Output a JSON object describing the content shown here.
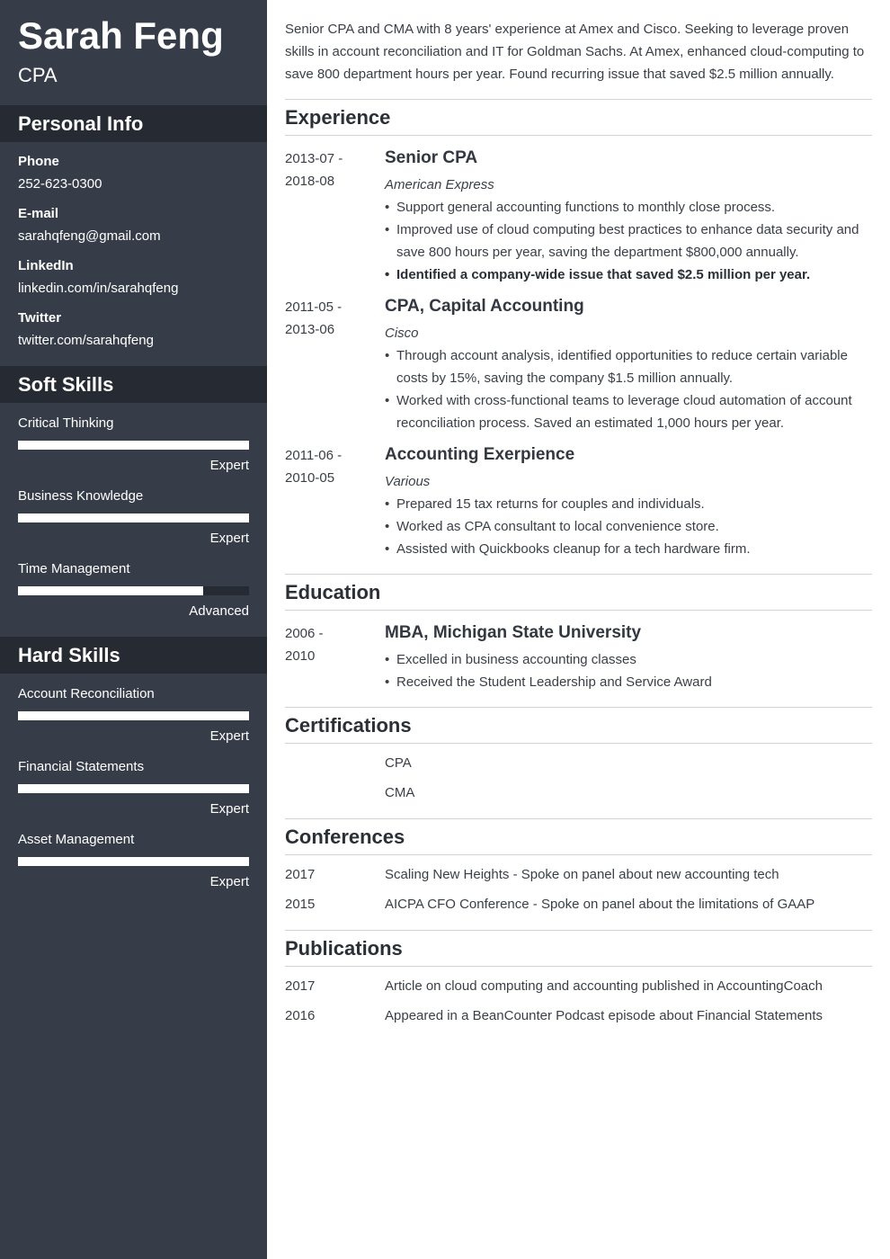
{
  "header": {
    "name": "Sarah Feng",
    "title": "CPA"
  },
  "sidebar": {
    "personal_info": {
      "heading": "Personal Info",
      "items": [
        {
          "label": "Phone",
          "value": "252-623-0300"
        },
        {
          "label": "E-mail",
          "value": "sarahqfeng@gmail.com"
        },
        {
          "label": "LinkedIn",
          "value": "linkedin.com/in/sarahqfeng"
        },
        {
          "label": "Twitter",
          "value": "twitter.com/sarahqfeng"
        }
      ]
    },
    "soft_skills": {
      "heading": "Soft Skills",
      "items": [
        {
          "name": "Critical Thinking",
          "level": "Expert",
          "fill_percent": 100
        },
        {
          "name": "Business Knowledge",
          "level": "Expert",
          "fill_percent": 100
        },
        {
          "name": "Time Management",
          "level": "Advanced",
          "fill_percent": 80
        }
      ]
    },
    "hard_skills": {
      "heading": "Hard Skills",
      "items": [
        {
          "name": "Account Reconciliation",
          "level": "Expert",
          "fill_percent": 100
        },
        {
          "name": "Financial Statements",
          "level": "Expert",
          "fill_percent": 100
        },
        {
          "name": "Asset Management",
          "level": "Expert",
          "fill_percent": 100
        }
      ]
    }
  },
  "main": {
    "summary": "Senior CPA and CMA with 8 years' experience at Amex and Cisco. Seeking to leverage proven skills in account reconciliation and IT for Goldman Sachs. At Amex, enhanced cloud-computing to save 800 department hours per year. Found recurring issue that saved $2.5 million annually.",
    "experience": {
      "heading": "Experience",
      "jobs": [
        {
          "date_start": "2013-07 -",
          "date_end": "2018-08",
          "title": "Senior CPA",
          "company": "American Express",
          "bullets": [
            "Support general accounting functions to monthly close process.",
            "Improved use of cloud computing best practices to enhance data security and save 800 hours per year, saving the department $800,000 annually.",
            "Identified a company-wide issue that saved $2.5 million per year."
          ]
        },
        {
          "date_start": "2011-05 -",
          "date_end": "2013-06",
          "title": "CPA, Capital Accounting",
          "company": "Cisco",
          "bullets": [
            "Through account analysis, identified opportunities to reduce certain variable costs by 15%, saving the company $1.5 million annually.",
            "Worked with cross-functional teams to leverage cloud automation of account reconciliation process. Saved an estimated 1,000 hours per year."
          ]
        },
        {
          "date_start": "2011-06 -",
          "date_end": "2010-05",
          "title": "Accounting Exerpience",
          "company": "Various",
          "bullets": [
            "Prepared 15 tax returns for couples and individuals.",
            "Worked as CPA consultant to local convenience store.",
            "Assisted with Quickbooks cleanup for a tech hardware firm."
          ]
        }
      ]
    },
    "education": {
      "heading": "Education",
      "date_start": "2006 -",
      "date_end": "2010",
      "degree": "MBA, Michigan State University",
      "bullets": [
        "Excelled in business accounting classes",
        "Received the Student Leadership and Service Award"
      ]
    },
    "certifications": {
      "heading": "Certifications",
      "items": [
        "CPA",
        "CMA"
      ]
    },
    "conferences": {
      "heading": "Conferences",
      "items": [
        {
          "year": "2017",
          "text": "Scaling New Heights - Spoke on panel about new accounting tech"
        },
        {
          "year": "2015",
          "text": "AICPA CFO Conference - Spoke on panel about the limitations of GAAP"
        }
      ]
    },
    "publications": {
      "heading": "Publications",
      "items": [
        {
          "year": "2017",
          "text": "Article on cloud computing and accounting published in AccountingCoach"
        },
        {
          "year": "2016",
          "text": "Appeared in a BeanCounter Podcast episode about Financial Statements"
        }
      ]
    }
  }
}
